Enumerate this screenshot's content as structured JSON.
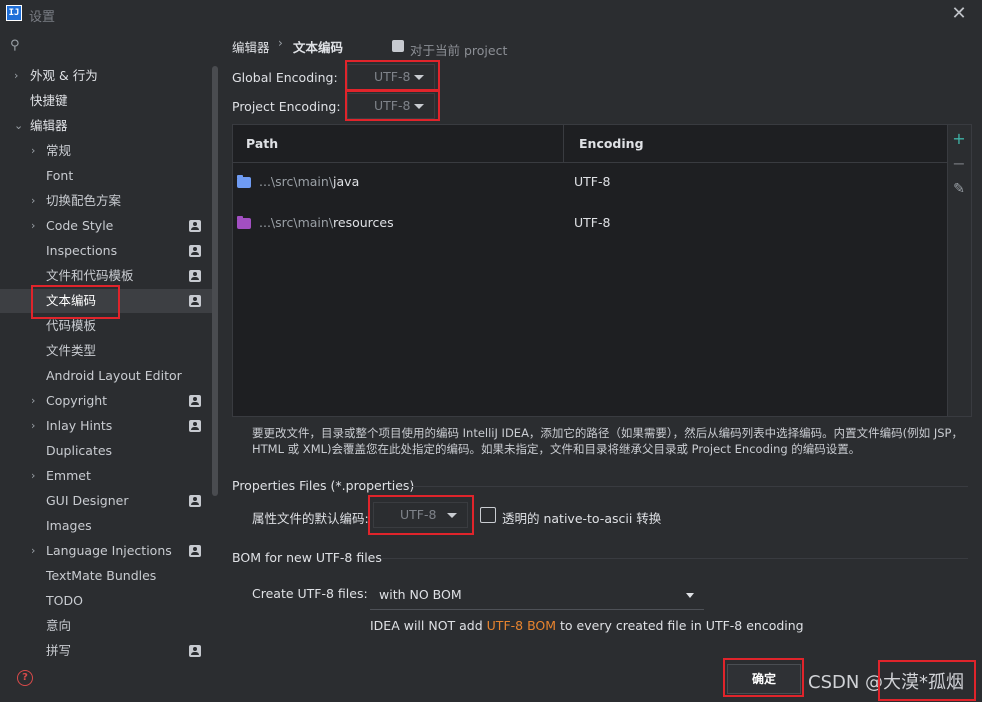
{
  "window": {
    "title": "设置",
    "app_icon": "IJ"
  },
  "search": {
    "placeholder": ""
  },
  "sidebar": {
    "items": [
      {
        "label": "外观 & 行为",
        "chevron": "›",
        "bold": true
      },
      {
        "label": "快捷键",
        "chevron": "",
        "bold": true
      },
      {
        "label": "编辑器",
        "chevron": "⌄",
        "bold": true
      },
      {
        "label": "常规",
        "chevron": "›"
      },
      {
        "label": "Font",
        "chevron": ""
      },
      {
        "label": "切换配色方案",
        "chevron": "›"
      },
      {
        "label": "Code Style",
        "chevron": "›",
        "scope": true
      },
      {
        "label": "Inspections",
        "chevron": "",
        "scope": true
      },
      {
        "label": "文件和代码模板",
        "chevron": "",
        "scope": true
      },
      {
        "label": "文本编码",
        "chevron": "",
        "scope": true,
        "selected": true
      },
      {
        "label": "代码模板",
        "chevron": ""
      },
      {
        "label": "文件类型",
        "chevron": ""
      },
      {
        "label": "Android Layout Editor",
        "chevron": ""
      },
      {
        "label": "Copyright",
        "chevron": "›",
        "scope": true
      },
      {
        "label": "Inlay Hints",
        "chevron": "›",
        "scope": true
      },
      {
        "label": "Duplicates",
        "chevron": ""
      },
      {
        "label": "Emmet",
        "chevron": "›"
      },
      {
        "label": "GUI Designer",
        "chevron": "",
        "scope": true
      },
      {
        "label": "Images",
        "chevron": ""
      },
      {
        "label": "Language Injections",
        "chevron": "›",
        "scope": true
      },
      {
        "label": "TextMate Bundles",
        "chevron": ""
      },
      {
        "label": "TODO",
        "chevron": ""
      },
      {
        "label": "意向",
        "chevron": ""
      },
      {
        "label": "拼写",
        "chevron": "",
        "scope": true
      }
    ]
  },
  "breadcrumb": {
    "parent": "编辑器",
    "separator": "›",
    "current": "文本编码",
    "scope_note": "对于当前 project"
  },
  "global_encoding": {
    "label": "Global Encoding:",
    "value": "UTF-8"
  },
  "project_encoding": {
    "label": "Project Encoding:",
    "value": "UTF-8"
  },
  "table": {
    "headers": {
      "path": "Path",
      "encoding": "Encoding"
    },
    "rows": [
      {
        "path_prefix": "...\\src\\main\\",
        "path_name": "java",
        "encoding": "UTF-8",
        "icon": "folder-icon",
        "icon_color": "#6f9bf3"
      },
      {
        "path_prefix": "...\\src\\main\\",
        "path_name": "resources",
        "encoding": "UTF-8",
        "icon": "resources-folder-icon",
        "icon_color": "#a24fc2"
      }
    ],
    "tools": {
      "add": "+",
      "remove": "−",
      "edit": "✎"
    }
  },
  "note": "要更改文件，目录或整个项目使用的编码 IntelliJ IDEA，添加它的路径（如果需要），然后从编码列表中选择编码。内置文件编码(例如 JSP，HTML 或 XML)会覆盖您在此处指定的编码。如果未指定，文件和目录将继承父目录或 Project Encoding 的编码设置。",
  "properties": {
    "group_title": "Properties Files (*.properties)",
    "default_label": "属性文件的默认编码:",
    "default_value": "UTF-8",
    "transparent_label": "透明的 native-to-ascii 转换",
    "transparent_checked": false
  },
  "bom": {
    "group_title": "BOM for new UTF-8 files",
    "create_label": "Create UTF-8 files:",
    "create_value": "with NO BOM",
    "hint_before": "IDEA will NOT add ",
    "hint_highlight": "UTF-8 BOM",
    "hint_after": " to every created file in UTF-8 encoding"
  },
  "footer": {
    "ok_label": "确定",
    "help_icon": "?"
  },
  "watermark": "CSDN @大漠*孤烟",
  "colors": {
    "accent_orange": "#e8842e",
    "highlight_red": "#e0242b",
    "selected_bg": "#3d3f43",
    "add_green": "#3fb2a6"
  }
}
